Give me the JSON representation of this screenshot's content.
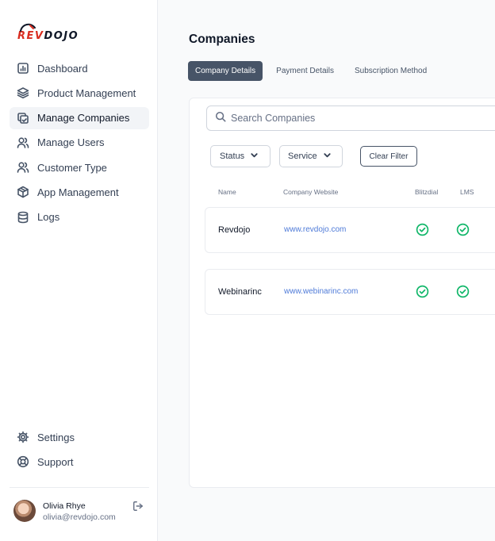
{
  "brand": {
    "logo_rev": "REV",
    "logo_dojo": "DOJO"
  },
  "sidebar": {
    "items": [
      {
        "label": "Dashboard",
        "icon": "bar-chart-icon"
      },
      {
        "label": "Product Management",
        "icon": "layers-icon"
      },
      {
        "label": "Manage Companies",
        "icon": "copy-icon",
        "active": true
      },
      {
        "label": "Manage Users",
        "icon": "users-icon"
      },
      {
        "label": "Customer Type",
        "icon": "users-icon"
      },
      {
        "label": "App Management",
        "icon": "cube-icon"
      },
      {
        "label": "Logs",
        "icon": "database-icon"
      }
    ],
    "bottom_items": [
      {
        "label": "Settings",
        "icon": "gear-icon"
      },
      {
        "label": "Support",
        "icon": "lifebuoy-icon"
      }
    ],
    "user": {
      "name": "Olivia Rhye",
      "email": "olivia@revdojo.com"
    }
  },
  "main": {
    "title": "Companies",
    "tabs": [
      {
        "label": "Company Details",
        "active": true
      },
      {
        "label": "Payment Details"
      },
      {
        "label": "Subscription Method"
      }
    ],
    "search": {
      "placeholder": "Search Companies",
      "value": ""
    },
    "filters": {
      "status_label": "Status",
      "service_label": "Service",
      "clear_label": "Clear Filter"
    },
    "table": {
      "columns": [
        "Name",
        "Company Website",
        "Blitzdial",
        "LMS"
      ],
      "rows": [
        {
          "name": "Revdojo",
          "website": "www.revdojo.com",
          "blitzdial": true,
          "lms": true
        },
        {
          "name": "Webinarinc",
          "website": "www.webinarinc.com",
          "blitzdial": true,
          "lms": true
        }
      ]
    }
  },
  "colors": {
    "accent": "#d92d20",
    "active_tab": "#475467",
    "link": "#4f7bd8",
    "check": "#12b76a"
  }
}
